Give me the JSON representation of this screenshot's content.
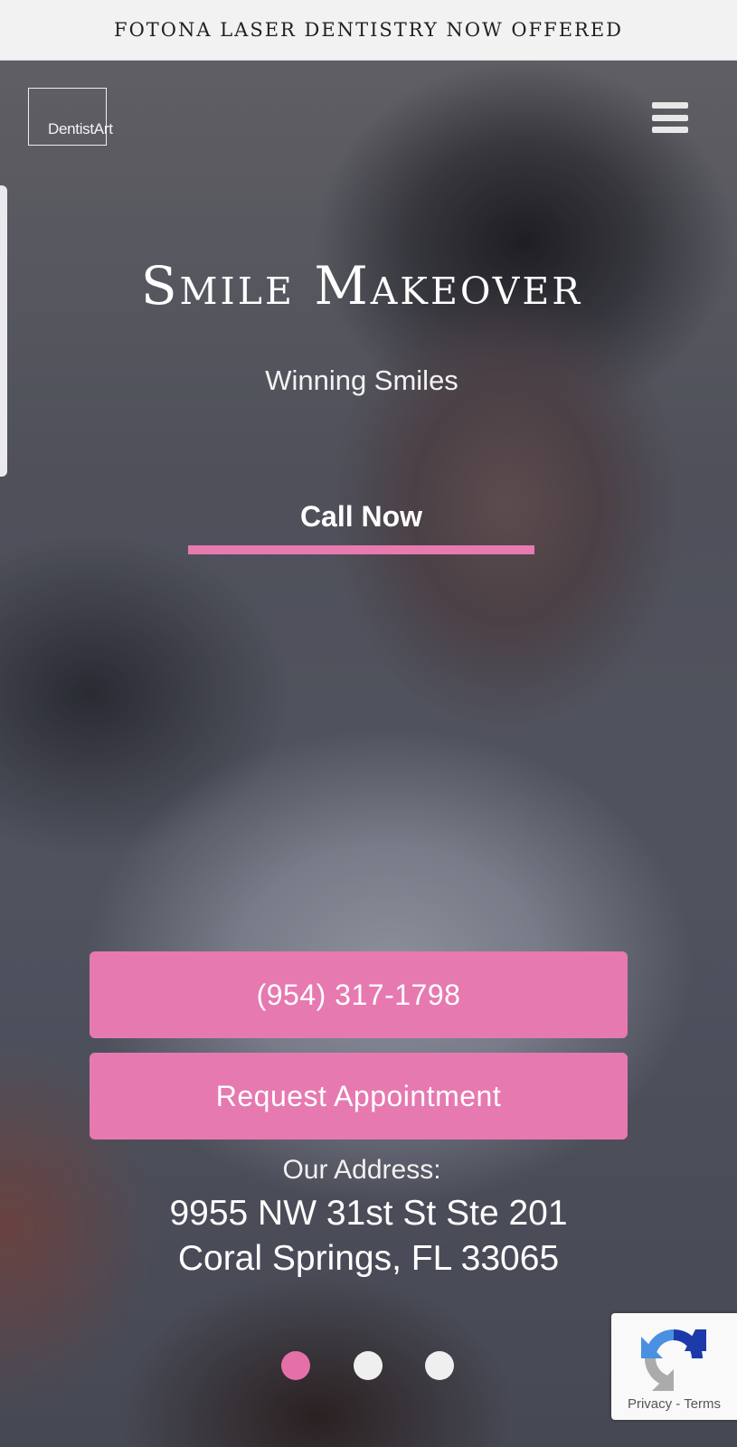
{
  "announcement": {
    "text": "FOTONA LASER DENTISTRY NOW OFFERED"
  },
  "header": {
    "logo_text": "DentistArt",
    "menu_icon": "hamburger-menu-icon"
  },
  "hero": {
    "headline": "Smile Makeover",
    "subheadline": "Winning Smiles",
    "cta_label": "Call Now"
  },
  "contact": {
    "phone_label": "(954) 317-1798",
    "appointment_label": "Request Appointment",
    "address_label": "Our Address:",
    "address_line1": "9955 NW 31st St Ste 201",
    "address_line2": "Coral Springs, FL 33065"
  },
  "carousel": {
    "slide_count": 3,
    "active_index": 0
  },
  "recaptcha": {
    "privacy": "Privacy",
    "separator": " - ",
    "terms": "Terms"
  },
  "colors": {
    "accent": "#e779b1",
    "active_dot": "#e56fa8",
    "topbar": "#f2f2f2"
  }
}
